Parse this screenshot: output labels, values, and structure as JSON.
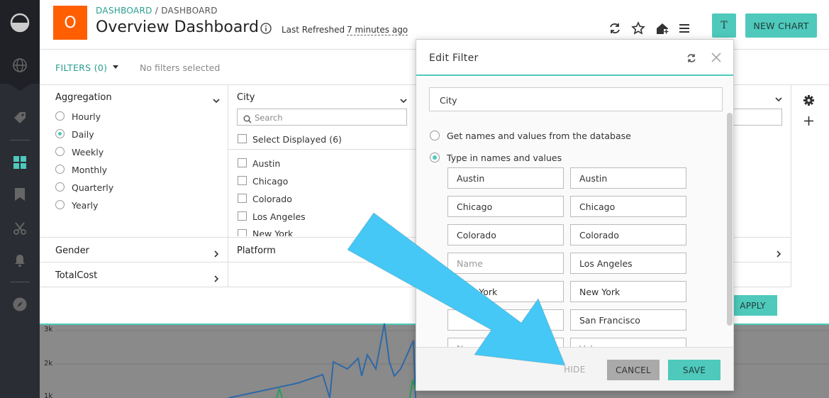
{
  "header": {
    "logo_letter": "O",
    "breadcrumb_1": "DASHBOARD",
    "breadcrumb_sep": " / ",
    "breadcrumb_2": "DASHBOARD",
    "title": "Overview Dashboard",
    "refreshed_label": "Last Refreshed",
    "refreshed_value": "7 minutes ago",
    "user_initial": "T",
    "new_chart_label": "NEW CHART"
  },
  "filterbar": {
    "filters_label": "FILTERS (0)",
    "no_filters": "No filters selected"
  },
  "filters": {
    "aggregation": {
      "title": "Aggregation",
      "options": [
        "Hourly",
        "Daily",
        "Weekly",
        "Monthly",
        "Quarterly",
        "Yearly"
      ],
      "selected": "Daily"
    },
    "city": {
      "title": "City",
      "search_placeholder": "Search",
      "select_displayed": "Select Displayed (6)",
      "items": [
        "Austin",
        "Chicago",
        "Colorado",
        "Los Angeles",
        "New York"
      ]
    },
    "gender": {
      "title": "Gender"
    },
    "platform": {
      "title": "Platform"
    },
    "totalcost": {
      "title": "TotalCost"
    },
    "apply_label": "APPLY"
  },
  "chart": {
    "y_ticks": [
      "3k",
      "2k",
      "1k"
    ]
  },
  "modal": {
    "title": "Edit Filter",
    "name_value": "City",
    "option_db": "Get names and values from the database",
    "option_type": "Type in names and values",
    "rows": [
      {
        "name": "Austin",
        "value": "Austin"
      },
      {
        "name": "Chicago",
        "value": "Chicago"
      },
      {
        "name": "Colorado",
        "value": "Colorado"
      },
      {
        "name": "",
        "value": "Los Angeles"
      },
      {
        "name": "New York",
        "value": "New York"
      },
      {
        "name": "",
        "value": "San Francisco"
      }
    ],
    "name_placeholder": "Name",
    "value_placeholder": "Value",
    "hide_label": "HIDE",
    "cancel_label": "CANCEL",
    "save_label": "SAVE"
  },
  "colors": {
    "accent": "#4ec9bc",
    "logo": "#ff5f00",
    "arrow": "#45c8f5",
    "nav": "#2a2d33"
  }
}
